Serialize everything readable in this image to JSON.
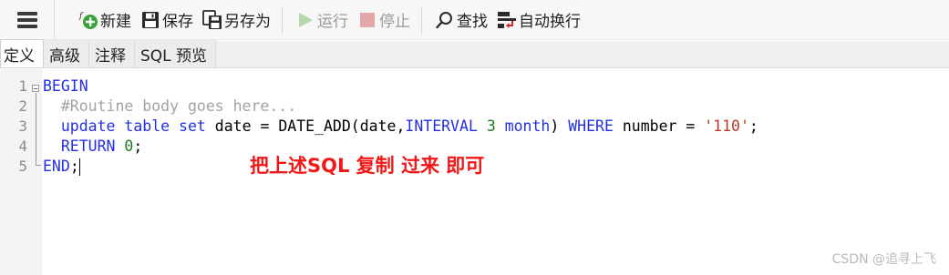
{
  "toolbar": {
    "new_label": "新建",
    "save_label": "保存",
    "save_as_label": "另存为",
    "run_label": "运行",
    "stop_label": "停止",
    "find_label": "查找",
    "wrap_label": "自动换行"
  },
  "tabs": [
    {
      "label": "定义",
      "active": true
    },
    {
      "label": "高级",
      "active": false
    },
    {
      "label": "注释",
      "active": false
    },
    {
      "label": "SQL 预览",
      "active": false
    }
  ],
  "editor": {
    "line_numbers": [
      "1",
      "2",
      "3",
      "4",
      "5"
    ],
    "line1": {
      "kw": "BEGIN"
    },
    "line2": {
      "indent": "  ",
      "comment": "#Routine body goes here..."
    },
    "line3": {
      "indent": "  ",
      "kw1": "update",
      "sp1": " ",
      "kw2": "table",
      "sp2": " ",
      "kw3": "set",
      "t1": " date = DATE_ADD(date,",
      "kw4": "INTERVAL",
      "sp3": " ",
      "num": "3",
      "sp4": " ",
      "kw5": "month",
      "t2": ") ",
      "kw6": "WHERE",
      "t3": " number = ",
      "str": "'110'",
      "t4": ";"
    },
    "line4": {
      "indent": "  ",
      "kw": "RETURN",
      "sp": " ",
      "num": "0",
      "t": ";"
    },
    "line5": {
      "kw": "END",
      "t": ";"
    }
  },
  "annotation": "把上述SQL 复制 过来 即可",
  "watermark": "CSDN @追寻上飞",
  "colors": {
    "keyword": "#2430e0",
    "comment": "#a3a3a3",
    "number": "#1d7a1d",
    "string": "#c0392b",
    "annotation": "#f21818"
  }
}
